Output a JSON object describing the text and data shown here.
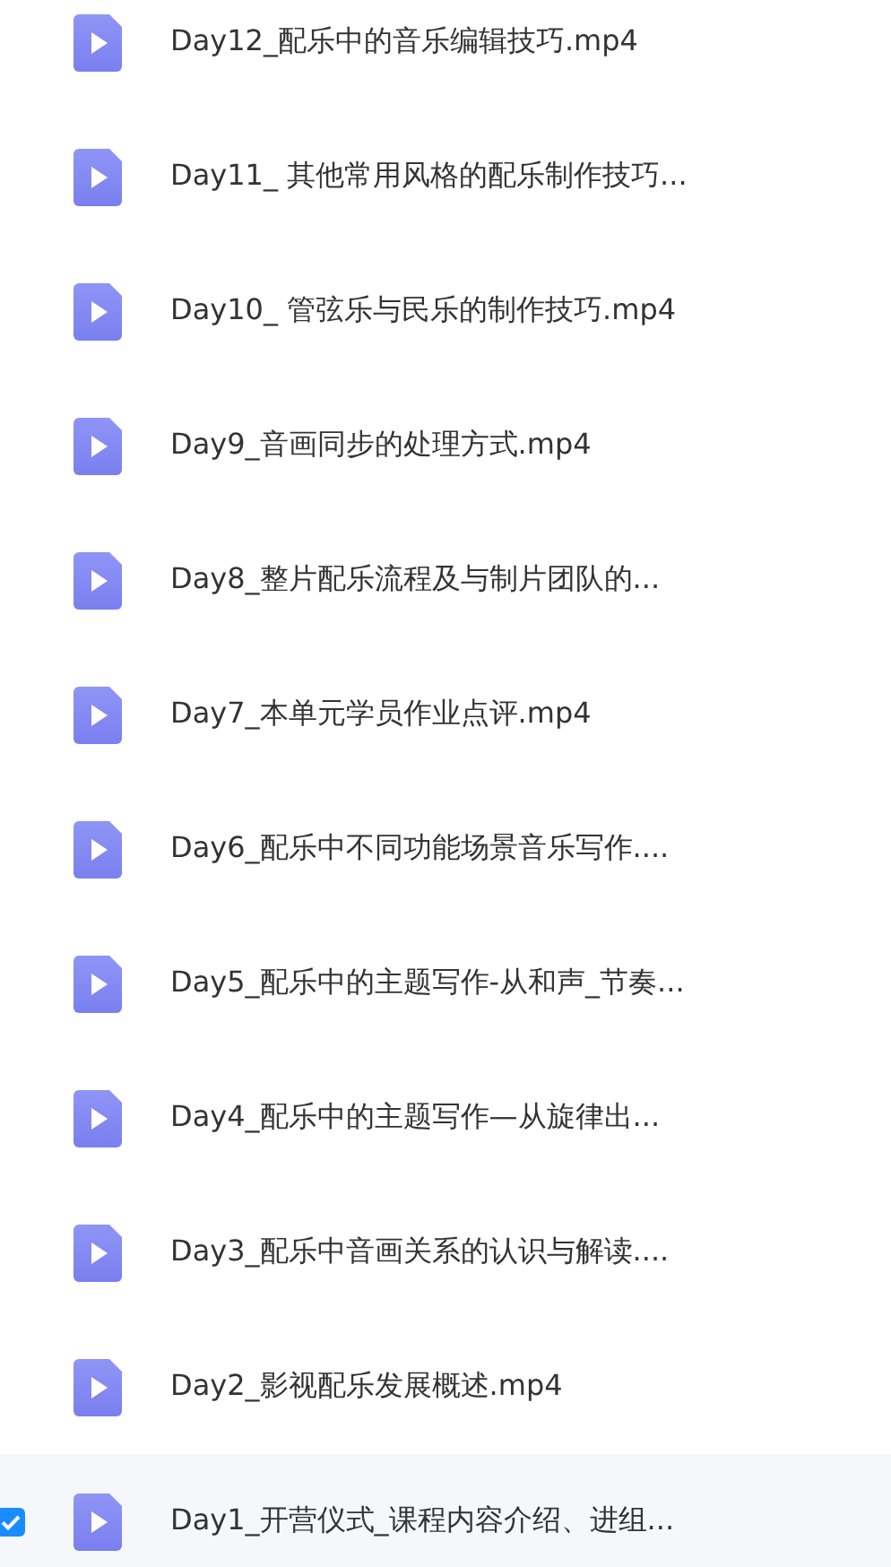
{
  "files": [
    {
      "name": "Day12_配乐中的音乐编辑技巧.mp4",
      "selected": false
    },
    {
      "name": "Day11_ 其他常用风格的配乐制作技巧...",
      "selected": false
    },
    {
      "name": "Day10_ 管弦乐与民乐的制作技巧.mp4",
      "selected": false
    },
    {
      "name": "Day9_音画同步的处理方式.mp4",
      "selected": false
    },
    {
      "name": "Day8_整片配乐流程及与制片团队的...",
      "selected": false
    },
    {
      "name": "Day7_本单元学员作业点评.mp4",
      "selected": false
    },
    {
      "name": "Day6_配乐中不同功能场景音乐写作....",
      "selected": false
    },
    {
      "name": "Day5_配乐中的主题写作-从和声_节奏...",
      "selected": false
    },
    {
      "name": "Day4_配乐中的主题写作—从旋律出...",
      "selected": false
    },
    {
      "name": "Day3_配乐中音画关系的认识与解读....",
      "selected": false
    },
    {
      "name": "Day2_影视配乐发展概述.mp4",
      "selected": false
    },
    {
      "name": "Day1_开营仪式_课程内容介绍、进组...",
      "selected": true
    }
  ]
}
